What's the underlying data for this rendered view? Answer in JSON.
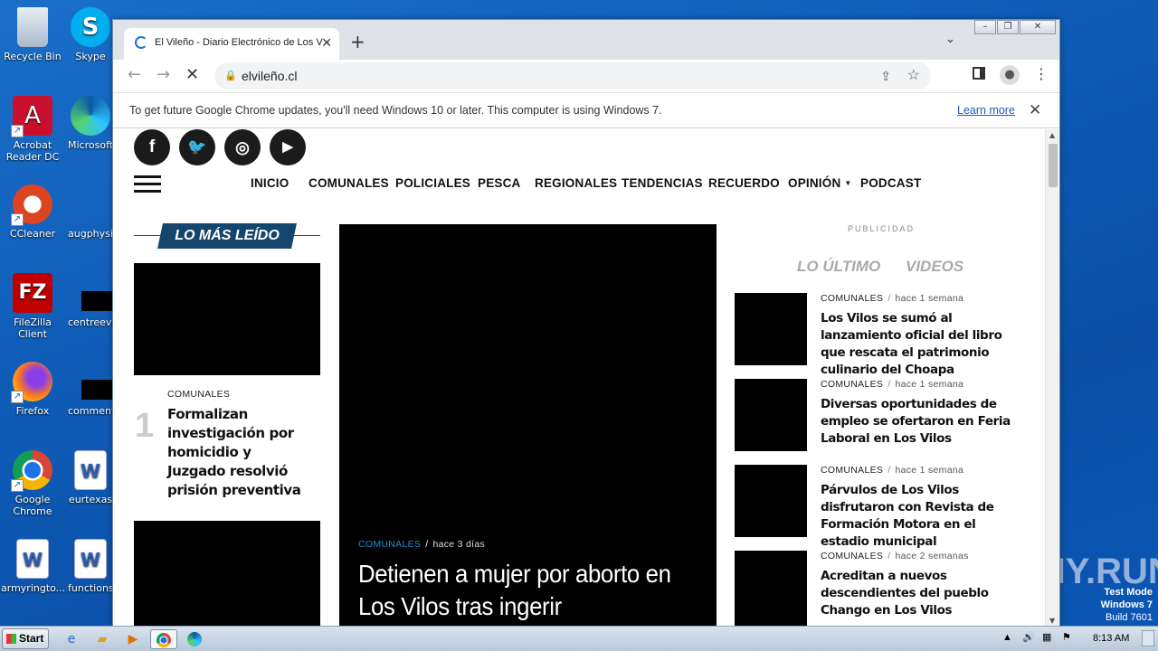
{
  "desktop": {
    "icons": [
      {
        "label": "Recycle Bin",
        "icon": "recycle-bin-icon"
      },
      {
        "label": "Acrobat Reader DC",
        "icon": "acrobat-icon"
      },
      {
        "label": "CCleaner",
        "icon": "ccleaner-icon"
      },
      {
        "label": "FileZilla Client",
        "icon": "filezilla-icon"
      },
      {
        "label": "Firefox",
        "icon": "firefox-icon"
      },
      {
        "label": "Google Chrome",
        "icon": "chrome-icon"
      },
      {
        "label": "armyringto...",
        "icon": "word-doc-icon"
      },
      {
        "label": "Skype",
        "icon": "skype-icon"
      },
      {
        "label": "Microsoft",
        "icon": "edge-icon"
      },
      {
        "label": "augphysic",
        "icon": "file-icon"
      },
      {
        "label": "centreeve",
        "icon": "file-icon"
      },
      {
        "label": "comment",
        "icon": "file-icon"
      },
      {
        "label": "eurtexas",
        "icon": "word-doc-icon"
      },
      {
        "label": "functions",
        "icon": "word-doc-icon"
      }
    ]
  },
  "browser": {
    "tab_title": "El Vileño - Diario Electrónico de Los V",
    "url": "elvileño.cl",
    "infobar_text": "To get future Google Chrome updates, you'll need Windows 10 or later. This computer is using Windows 7.",
    "infobar_link": "Learn more"
  },
  "site": {
    "nav": [
      "INICIO",
      "COMUNALES",
      "POLICIALES",
      "PESCA",
      "REGIONALES",
      "TENDENCIAS",
      "RECUERDO",
      "OPINIÓN",
      "PODCAST"
    ],
    "most_read_title": "LO MÁS LEÍDO",
    "most_read": [
      {
        "rank": "1",
        "category": "COMUNALES",
        "title": "Formalizan investigación por homicidio y Juzgado resolvió prisión preventiva"
      }
    ],
    "featured": {
      "category": "COMUNALES",
      "time": "hace 3 días",
      "title": "Detienen a mujer por aborto en Los Vilos tras ingerir"
    },
    "publicidad": "PUBLICIDAD",
    "right_tabs": [
      "LO ÚLTIMO",
      "VIDEOS"
    ],
    "latest": [
      {
        "category": "COMUNALES",
        "time": "hace 1 semana",
        "title": "Los Vilos se sumó al lanzamiento oficial del libro que rescata el patrimonio culinario del Choapa"
      },
      {
        "category": "COMUNALES",
        "time": "hace 1 semana",
        "title": "Diversas oportunidades de empleo se ofertaron en Feria Laboral en Los Vilos"
      },
      {
        "category": "COMUNALES",
        "time": "hace 1 semana",
        "title": "Párvulos de Los Vilos disfrutaron con Revista de Formación Motora en el estadio municipal"
      },
      {
        "category": "COMUNALES",
        "time": "hace 2 semanas",
        "title": "Acreditan a nuevos descendientes del pueblo Chango en Los Vilos"
      }
    ]
  },
  "taskbar": {
    "start": "Start",
    "time": "8:13 AM"
  },
  "os": {
    "testmode_line1": "Test Mode",
    "testmode_line2": "Windows 7",
    "testmode_line3": "Build 7601",
    "watermark": "ANY.RUN"
  }
}
